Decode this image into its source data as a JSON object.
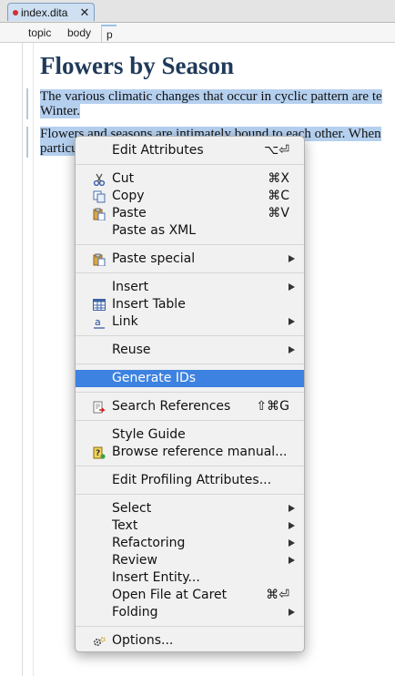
{
  "tab": {
    "label": "index.dita",
    "close": "✕"
  },
  "breadcrumb": [
    "topic",
    "body",
    "p"
  ],
  "document": {
    "title": "Flowers by Season",
    "para1_line1": "The various climatic changes that occur in cyclic pattern are te",
    "para1_line2": "Winter.",
    "para2_line1": "Flowers and seasons are intimately bound to each other. When",
    "para2_line2": "particu"
  },
  "menu": {
    "edit_attributes": {
      "label": "Edit Attributes",
      "shortcut": "⌥⏎"
    },
    "cut": {
      "label": "Cut",
      "shortcut": "⌘X",
      "icon": "scissors-icon"
    },
    "copy": {
      "label": "Copy",
      "shortcut": "⌘C",
      "icon": "copy-icon"
    },
    "paste": {
      "label": "Paste",
      "shortcut": "⌘V",
      "icon": "clipboard-icon"
    },
    "paste_xml": {
      "label": "Paste as XML"
    },
    "paste_special": {
      "label": "Paste special",
      "icon": "clipboard-icon"
    },
    "insert": {
      "label": "Insert"
    },
    "insert_table": {
      "label": "Insert Table",
      "icon": "table-icon"
    },
    "link": {
      "label": "Link",
      "icon": "link-icon"
    },
    "reuse": {
      "label": "Reuse"
    },
    "generate_ids": {
      "label": "Generate IDs"
    },
    "search_references": {
      "label": "Search References",
      "shortcut": "⇧⌘G",
      "icon": "search-references-icon"
    },
    "style_guide": {
      "label": "Style Guide"
    },
    "browse_manual": {
      "label": "Browse reference manual...",
      "icon": "help-book-icon"
    },
    "edit_profiling": {
      "label": "Edit Profiling Attributes..."
    },
    "select": {
      "label": "Select"
    },
    "text": {
      "label": "Text"
    },
    "refactoring": {
      "label": "Refactoring"
    },
    "review": {
      "label": "Review"
    },
    "insert_entity": {
      "label": "Insert Entity..."
    },
    "open_file": {
      "label": "Open File at Caret",
      "shortcut": "⌘⏎"
    },
    "folding": {
      "label": "Folding"
    },
    "options": {
      "label": "Options...",
      "icon": "gears-icon"
    }
  },
  "colors": {
    "highlight": "#3d82e0",
    "selection": "#b5d0ef",
    "title": "#1f3a5a"
  }
}
